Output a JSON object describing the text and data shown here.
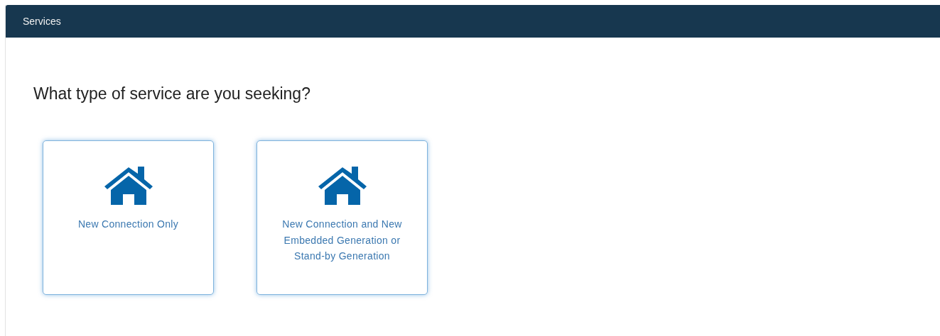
{
  "panel": {
    "title": "Services"
  },
  "question": "What type of service are you seeking?",
  "options": [
    {
      "label": "New Connection Only"
    },
    {
      "label": "New Connection and New Embedded Generation or Stand-by Generation"
    }
  ]
}
